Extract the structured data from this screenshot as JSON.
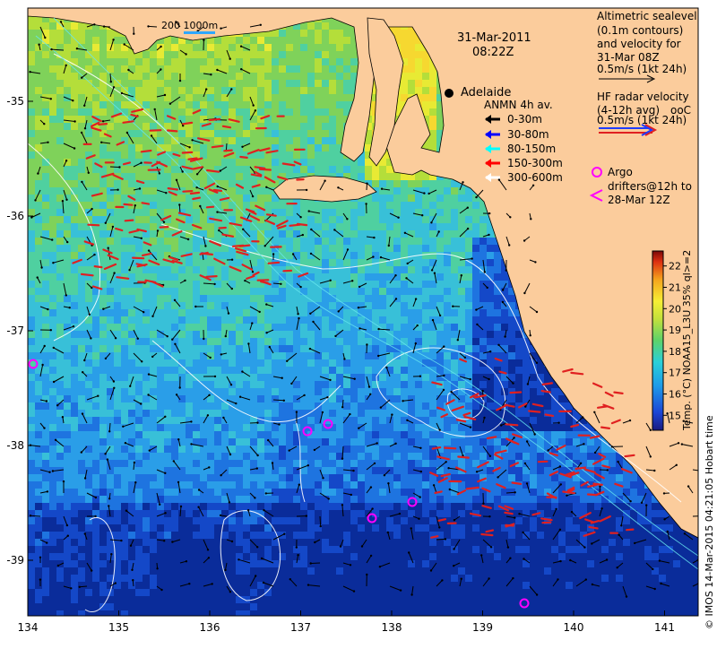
{
  "map": {
    "date": "31-Mar-2011",
    "time": "08:22Z",
    "city": "Adelaide",
    "scale_bar": "200  1000m",
    "x_ticks": [
      "134",
      "135",
      "136",
      "137",
      "138",
      "139",
      "140",
      "141"
    ],
    "y_ticks": [
      "-35",
      "-36",
      "-37",
      "-38",
      "-39"
    ]
  },
  "legend": {
    "altimetry_lines": [
      "Altimetric sealevel",
      "(0.1m contours)",
      "and velocity for",
      "31-Mar 08Z",
      "0.5m/s (1kt 24h)"
    ],
    "hf_lines": [
      "HF radar velocity",
      "(4-12h avg)",
      "0.5m/s (1kt 24h)"
    ],
    "hf_code": "ooC",
    "anmn_title": "ANMN 4h av.",
    "anmn_items": [
      {
        "label": "0-30m",
        "color": "#000000"
      },
      {
        "label": "30-80m",
        "color": "#0000ff"
      },
      {
        "label": "80-150m",
        "color": "#00ffff"
      },
      {
        "label": "150-300m",
        "color": "#ff0000"
      },
      {
        "label": "300-600m",
        "color": "#ffffff"
      }
    ],
    "argo_lines": [
      "Argo",
      "drifters@12h to",
      "28-Mar 12Z"
    ]
  },
  "colorbar": {
    "label": "Temp. (°C) NOAA15_L3U 35% ql>=2",
    "ticks": [
      "15",
      "16",
      "17",
      "18",
      "19",
      "20",
      "21",
      "22"
    ],
    "min": 14.3,
    "max": 22.7
  },
  "credit": "© IMOS 14-Mar-2015 04:21:05 Hobart time",
  "colors": {
    "land": "#fbcc9c",
    "warm": "#f5e64a",
    "mid": "#7fd25a",
    "cool": "#2a8fd8",
    "cold": "#0a2c9a",
    "hf": "#e02020",
    "argo": "#ff00ff"
  }
}
